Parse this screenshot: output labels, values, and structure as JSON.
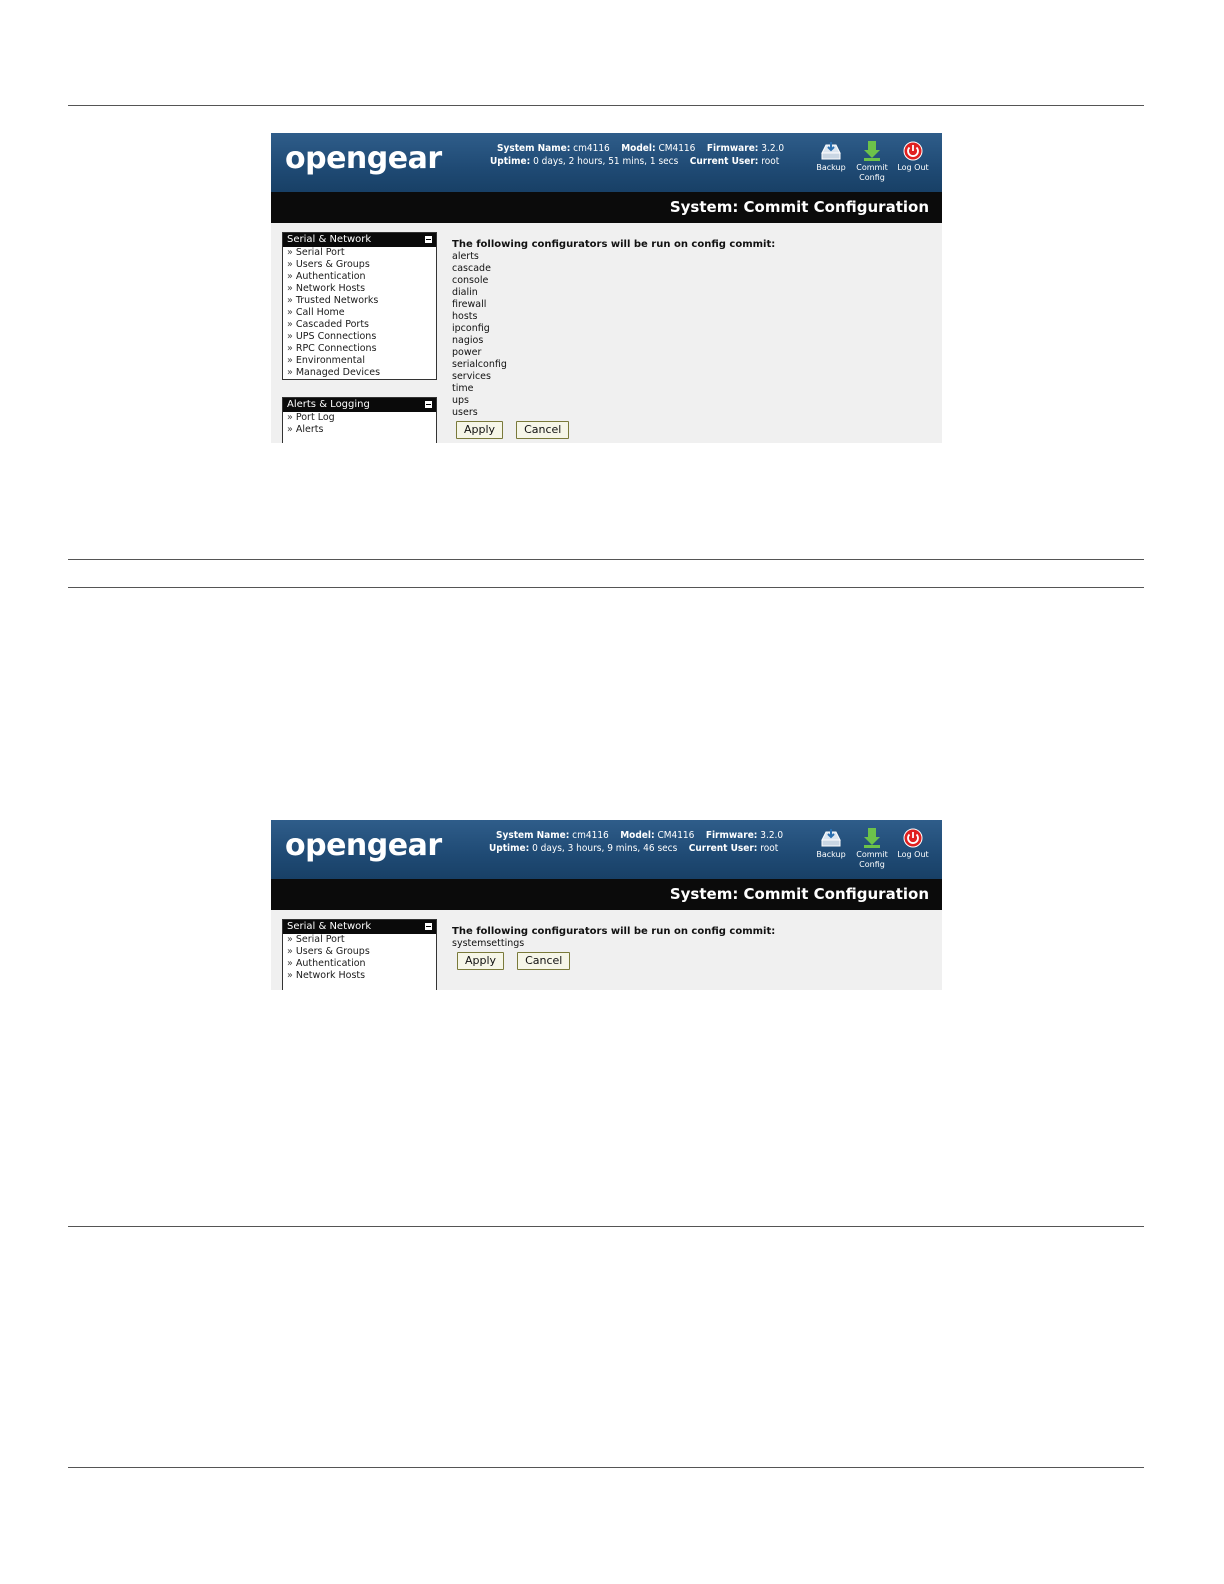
{
  "screenshot1": {
    "logo": "opengear",
    "system_name_label": "System Name:",
    "system_name": "cm4116",
    "model_label": "Model:",
    "model": "CM4116",
    "firmware_label": "Firmware:",
    "firmware": "3.2.0",
    "uptime_label": "Uptime:",
    "uptime": "0 days, 2 hours, 51 mins, 1 secs",
    "current_user_label": "Current User:",
    "current_user": "root",
    "toolbar": {
      "backup": "Backup",
      "commit_line1": "Commit",
      "commit_line2": "Config",
      "logout": "Log Out"
    },
    "page_title": "System: Commit Configuration",
    "menus": [
      {
        "title": "Serial & Network",
        "items": [
          "Serial Port",
          "Users & Groups",
          "Authentication",
          "Network Hosts",
          "Trusted Networks",
          "Call Home",
          "Cascaded Ports",
          "UPS Connections",
          "RPC Connections",
          "Environmental",
          "Managed Devices"
        ]
      },
      {
        "title": "Alerts & Logging",
        "items": [
          "Port Log",
          "Alerts"
        ]
      }
    ],
    "lead_text": "The following configurators will be run on config commit:",
    "configurators": [
      "alerts",
      "cascade",
      "console",
      "dialin",
      "firewall",
      "hosts",
      "ipconfig",
      "nagios",
      "power",
      "serialconfig",
      "services",
      "time",
      "ups",
      "users"
    ],
    "apply_label": "Apply",
    "cancel_label": "Cancel"
  },
  "screenshot2": {
    "logo": "opengear",
    "system_name_label": "System Name:",
    "system_name": "cm4116",
    "model_label": "Model:",
    "model": "CM4116",
    "firmware_label": "Firmware:",
    "firmware": "3.2.0",
    "uptime_label": "Uptime:",
    "uptime": "0 days, 3 hours, 9 mins, 46 secs",
    "current_user_label": "Current User:",
    "current_user": "root",
    "toolbar": {
      "backup": "Backup",
      "commit_line1": "Commit",
      "commit_line2": "Config",
      "logout": "Log Out"
    },
    "page_title": "System: Commit Configuration",
    "menus": [
      {
        "title": "Serial & Network",
        "items": [
          "Serial Port",
          "Users & Groups",
          "Authentication",
          "Network Hosts"
        ]
      }
    ],
    "lead_text": "The following configurators will be run on config commit:",
    "configurators": [
      "systemsettings"
    ],
    "apply_label": "Apply",
    "cancel_label": "Cancel"
  }
}
